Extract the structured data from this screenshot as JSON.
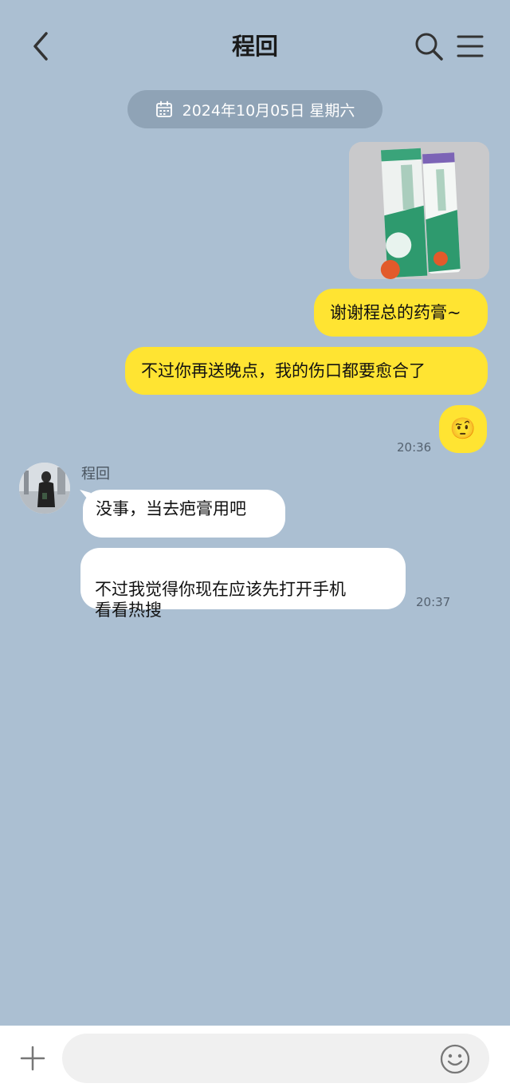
{
  "header": {
    "title": "程回",
    "back_icon": "chevron-left-icon",
    "search_icon": "search-icon",
    "menu_icon": "menu-icon"
  },
  "date_separator": {
    "text": "2024年10月05日 星期六",
    "icon": "calendar-icon"
  },
  "messages": [
    {
      "from": "me",
      "type": "image",
      "content": "medicine-tube-photo"
    },
    {
      "from": "me",
      "type": "text",
      "text": "谢谢程总的药膏~"
    },
    {
      "from": "me",
      "type": "text",
      "text": "不过你再送晚点，我的伤口都要愈合了"
    },
    {
      "from": "me",
      "type": "emoji",
      "text": "🤨",
      "time": "20:36"
    },
    {
      "from": "them",
      "type": "text",
      "text": "没事，当去疤膏用吧",
      "sender": "程回"
    },
    {
      "from": "them",
      "type": "text",
      "text": "不过我觉得你现在应该先打开手机\n看看热搜",
      "time": "20:37"
    }
  ],
  "input": {
    "value": "",
    "plus_icon": "plus-icon",
    "emoji_icon": "smiley-icon"
  },
  "colors": {
    "background": "#abbfd2",
    "my_bubble": "#ffe432",
    "their_bubble": "#ffffff"
  }
}
